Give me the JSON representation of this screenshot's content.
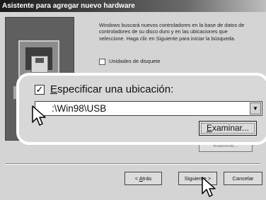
{
  "window": {
    "title": "Asistente para agregar nuevo hardware"
  },
  "description": "Windows buscará nuevos controladores en la base de datos de controladores de su disco duro y en las ubicaciones que seleccione. Haga clic en Siguiente para iniciar la búsqueda.",
  "floppy_option": {
    "label": "Unidades de disquete",
    "checked": false
  },
  "location_option": {
    "label_accel": "E",
    "label_rest": "specificar una ubicación:",
    "checked": true,
    "check_glyph": "✓"
  },
  "location_combo": {
    "value": ":\\Win98\\USB",
    "dropdown_glyph": "▼"
  },
  "browse_button": {
    "accel": "E",
    "rest": "xaminar..."
  },
  "browse_button_behind": {
    "label": "Examinar..."
  },
  "footer": {
    "back": {
      "arrow": "< ",
      "accel": "A",
      "rest": "trás"
    },
    "next": {
      "rest": "Siguiente",
      "arrow": " >"
    },
    "cancel": {
      "label": "Cancelar"
    }
  },
  "colors": {
    "dialog_bg": "#d4d4d4",
    "zoom_panel_border": "#ffffff",
    "title_bar": "#1a1a1a"
  }
}
